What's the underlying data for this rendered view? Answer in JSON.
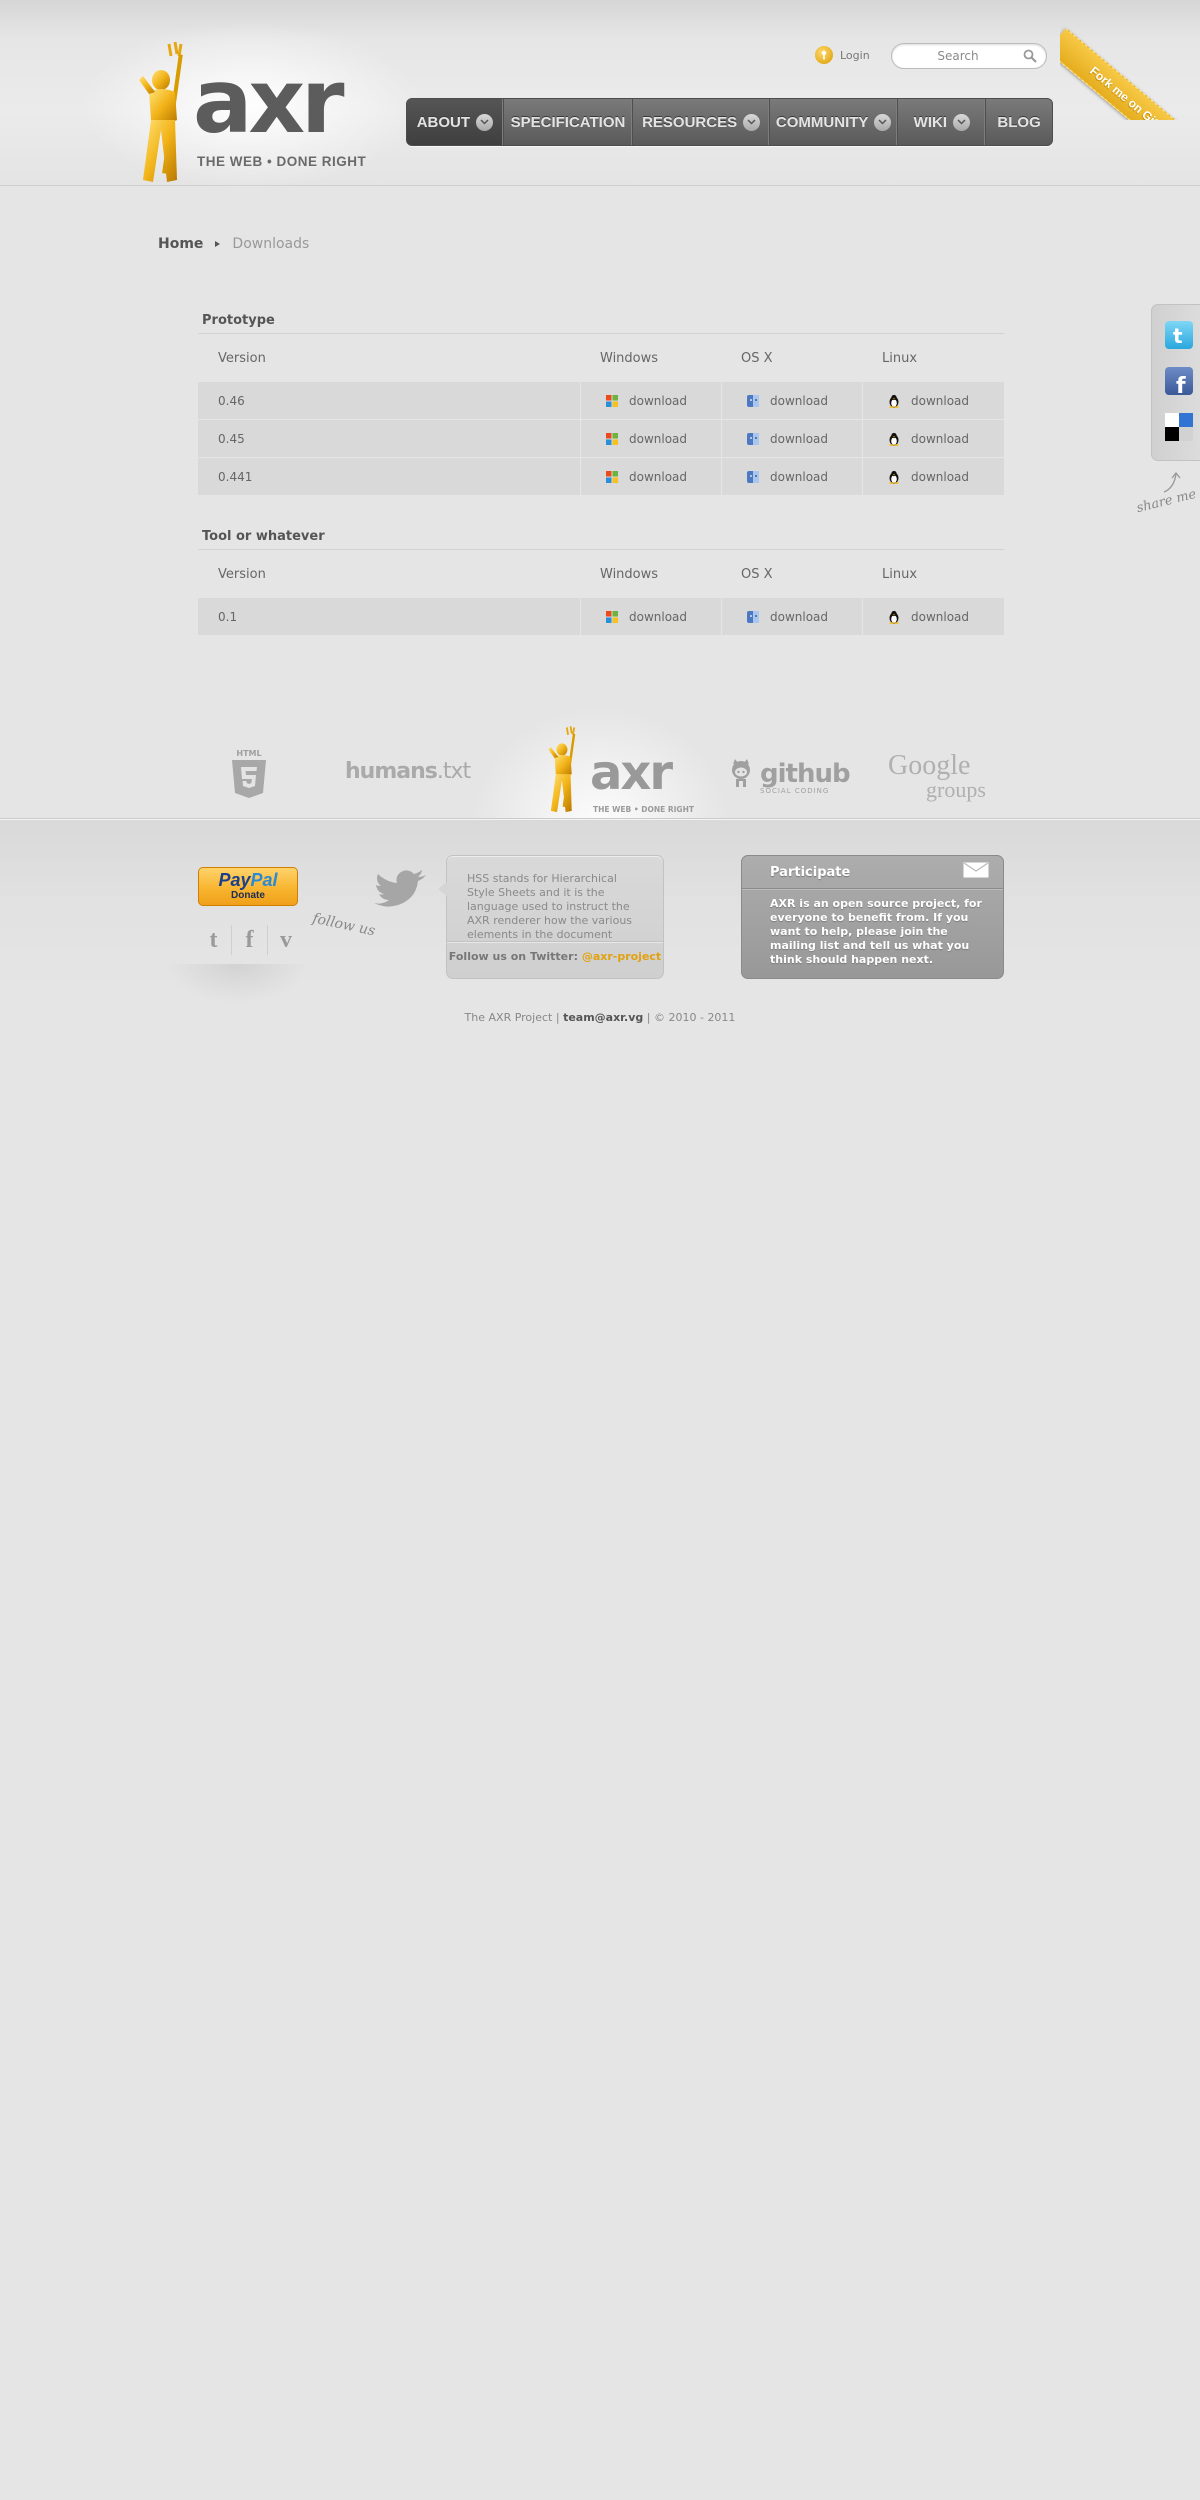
{
  "header": {
    "brand": "axr",
    "tagline": "THE WEB  •  DONE RIGHT",
    "login_label": "Login",
    "search_placeholder": "Search",
    "ribbon": "Fork me on GitHub",
    "nav": [
      {
        "label": "ABOUT",
        "dropdown": true,
        "active": true
      },
      {
        "label": "SPECIFICATION",
        "dropdown": false
      },
      {
        "label": "RESOURCES",
        "dropdown": true
      },
      {
        "label": "COMMUNITY",
        "dropdown": true
      },
      {
        "label": "WIKI",
        "dropdown": true
      },
      {
        "label": "BLOG",
        "dropdown": false
      }
    ]
  },
  "share": {
    "label": "share me",
    "items": [
      {
        "name": "twitter",
        "icon": "twitter-icon",
        "color": "#2aa7de"
      },
      {
        "name": "facebook",
        "icon": "facebook-icon",
        "color": "#3b5998"
      },
      {
        "name": "delicious",
        "icon": "delicious-icon",
        "color": "#3274d1"
      }
    ]
  },
  "breadcrumb": {
    "home": "Home",
    "current": "Downloads"
  },
  "sections": [
    {
      "title": "Prototype",
      "columns": [
        "Version",
        "Windows",
        "OS X",
        "Linux"
      ],
      "rows": [
        {
          "version": "0.46",
          "windows": "download",
          "osx": "download",
          "linux": "download"
        },
        {
          "version": "0.45",
          "windows": "download",
          "osx": "download",
          "linux": "download"
        },
        {
          "version": "0.441",
          "windows": "download",
          "osx": "download",
          "linux": "download"
        }
      ]
    },
    {
      "title": "Tool or whatever",
      "columns": [
        "Version",
        "Windows",
        "OS X",
        "Linux"
      ],
      "rows": [
        {
          "version": "0.1",
          "windows": "download",
          "osx": "download",
          "linux": "download"
        }
      ]
    }
  ],
  "partners": {
    "html5": "HTML",
    "humans_bold": "humans",
    "humans_rest": ".txt",
    "axr_word": "axr",
    "axr_tag": "THE WEB  •  DONE RIGHT",
    "github_word": "github",
    "github_tag": "SOCIAL CODING",
    "google_1": "Google",
    "google_2": "groups"
  },
  "footer": {
    "paypal_logo_a": "Pay",
    "paypal_logo_b": "Pal",
    "paypal_sub": "Donate",
    "follow_label": "follow us",
    "social": [
      {
        "glyph": "t",
        "icon": "twitter-icon"
      },
      {
        "glyph": "f",
        "icon": "facebook-icon"
      },
      {
        "glyph": "v",
        "icon": "vimeo-icon"
      }
    ],
    "tweet_text": "HSS stands for Hierarchical Style Sheets and it is the language used to instruct the AXR renderer how the various elements in the document",
    "follow_twitter_prefix": "Follow us on Twitter:",
    "twitter_handle": "@axr-project",
    "participate_title": "Participate",
    "participate_text": "AXR is an open source project, for everyone to benefit from. If you want to help, please join the mailing list and tell us what you think should happen next.",
    "copyright_project": "The AXR Project",
    "copyright_email": "team@axr.vg",
    "copyright_years": "© 2010 - 2011",
    "copyright_sep": "|"
  },
  "colors": {
    "accent": "#e2a10f",
    "background": "#e5e5e5",
    "nav": "#5a5a5a"
  }
}
